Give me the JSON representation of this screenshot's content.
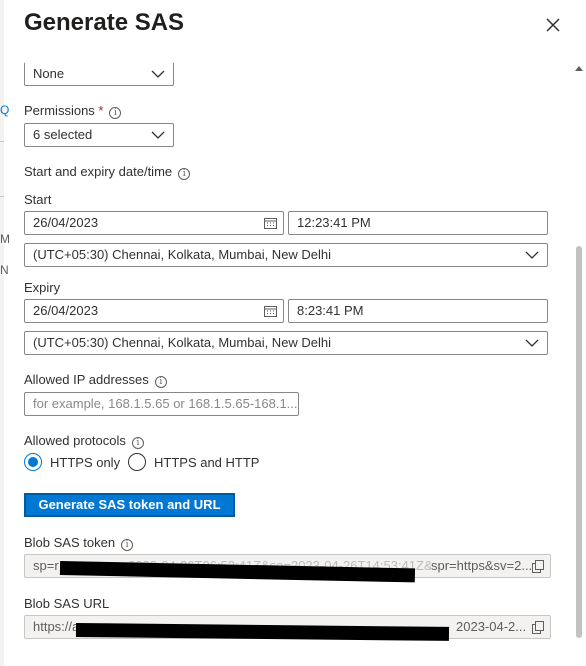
{
  "panel": {
    "title": "Generate SAS",
    "close_label": "×"
  },
  "fields": {
    "top_select_value": "None",
    "permissions_label": "Permissions",
    "required_marker": "*",
    "permissions_value": "6 selected",
    "date_section_label": "Start and expiry date/time",
    "start_label": "Start",
    "start_date": "26/04/2023",
    "start_time": "12:23:41 PM",
    "start_timezone": "(UTC+05:30) Chennai, Kolkata, Mumbai, New Delhi",
    "expiry_label": "Expiry",
    "expiry_date": "26/04/2023",
    "expiry_time": "8:23:41 PM",
    "expiry_timezone": "(UTC+05:30) Chennai, Kolkata, Mumbai, New Delhi",
    "ip_label": "Allowed IP addresses",
    "ip_placeholder": "for example, 168.1.5.65 or 168.1.5.65-168.1....",
    "protocols_label": "Allowed protocols",
    "protocol_options": [
      "HTTPS only",
      "HTTPS and HTTP"
    ],
    "protocol_selected": "HTTPS only"
  },
  "actions": {
    "generate_label": "Generate SAS token and URL"
  },
  "output": {
    "token_label": "Blob SAS token",
    "token_visible_start": "sp=r",
    "token_visible_mid": "2023-04-26T06:53:41Z&se=2023-04-26T14:53:41Z&sip=",
    "token_visible_end": "spr=https&sv=2...",
    "url_label": "Blob SAS URL",
    "url_visible_start": "https://a",
    "url_visible_end": "2023-04-2..."
  },
  "edge_fragments": {
    "q": "Q",
    "m": "M",
    "n": "N"
  },
  "colors": {
    "accent": "#0078d4",
    "required": "#a4262c",
    "text": "#323130"
  }
}
